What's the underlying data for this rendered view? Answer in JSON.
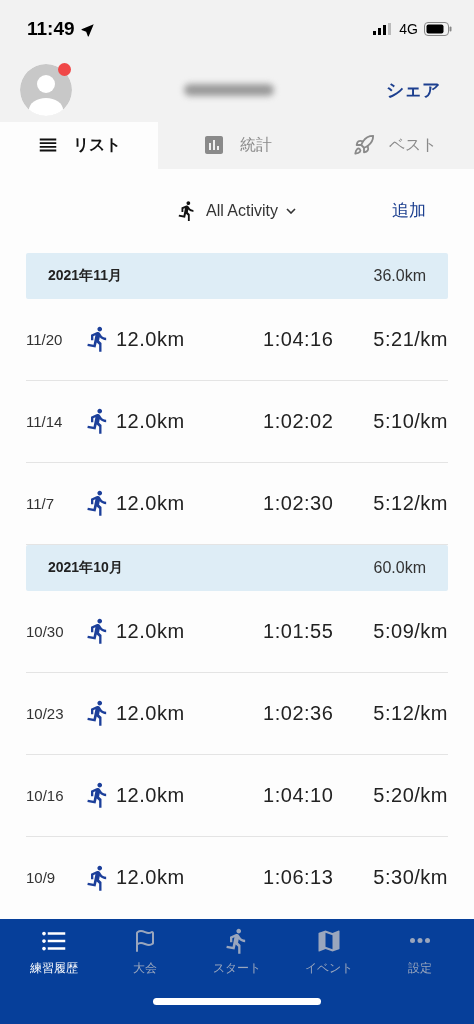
{
  "status_bar": {
    "time": "11:49",
    "network": "4G"
  },
  "header": {
    "share": "シェア",
    "notification": true
  },
  "tabs": [
    {
      "kind": "list",
      "label": "リスト",
      "selected": true
    },
    {
      "kind": "stats",
      "label": "統計",
      "selected": false
    },
    {
      "kind": "best",
      "label": "ベスト",
      "selected": false
    }
  ],
  "filter": {
    "label": "All Activity",
    "add": "追加"
  },
  "months": [
    {
      "label": "2021年11月",
      "total": "36.0km",
      "activities": [
        {
          "date": "11/20",
          "distance": "12.0km",
          "duration": "1:04:16",
          "pace": "5:21/km"
        },
        {
          "date": "11/14",
          "distance": "12.0km",
          "duration": "1:02:02",
          "pace": "5:10/km"
        },
        {
          "date": "11/7",
          "distance": "12.0km",
          "duration": "1:02:30",
          "pace": "5:12/km"
        }
      ]
    },
    {
      "label": "2021年10月",
      "total": "60.0km",
      "activities": [
        {
          "date": "10/30",
          "distance": "12.0km",
          "duration": "1:01:55",
          "pace": "5:09/km"
        },
        {
          "date": "10/23",
          "distance": "12.0km",
          "duration": "1:02:36",
          "pace": "5:12/km"
        },
        {
          "date": "10/16",
          "distance": "12.0km",
          "duration": "1:04:10",
          "pace": "5:20/km"
        },
        {
          "date": "10/9",
          "distance": "12.0km",
          "duration": "1:06:13",
          "pace": "5:30/km"
        }
      ]
    }
  ],
  "nav": [
    {
      "kind": "history",
      "label": "練習履歴",
      "selected": true
    },
    {
      "kind": "race",
      "label": "大会",
      "selected": false
    },
    {
      "kind": "start",
      "label": "スタート",
      "selected": false
    },
    {
      "kind": "event",
      "label": "イベント",
      "selected": false
    },
    {
      "kind": "settings",
      "label": "設定",
      "selected": false
    }
  ]
}
